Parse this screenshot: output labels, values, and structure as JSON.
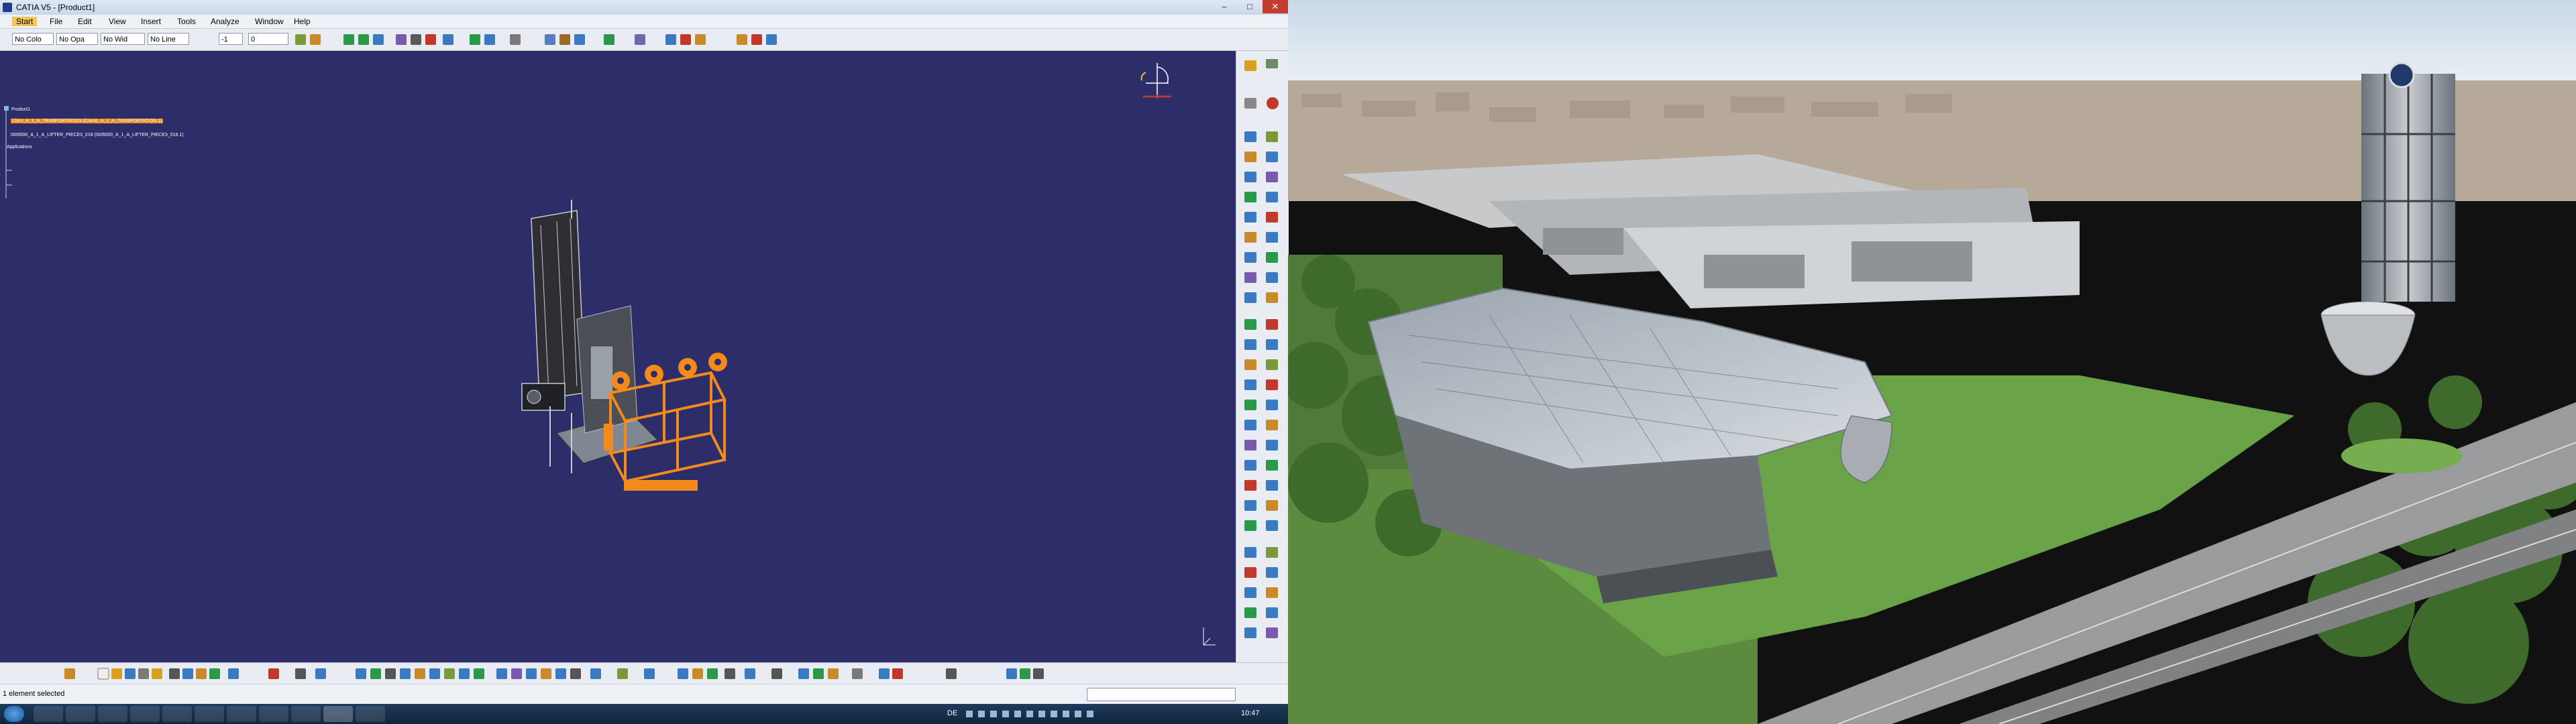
{
  "window": {
    "title": "CATIA V5 - [Product1]",
    "minimize": "–",
    "maximize": "□",
    "close": "✕"
  },
  "menu": {
    "items": [
      "Start",
      "File",
      "Edit",
      "View",
      "Insert",
      "Tools",
      "Analyze",
      "Window",
      "Help"
    ]
  },
  "toolbar": {
    "combos": [
      "No Colo",
      "No Opa",
      "No Wid",
      "No Line",
      "-1",
      "0"
    ]
  },
  "tree": {
    "root": "Product1",
    "selected_item": "Clam_A_1_A_TRASPORTATION (Clamp_A_1_A_TRASPORTATION.1)",
    "second_item": "00/6000_A_1_A_LIFTER_PIECE3_018 (00/6000_A_1_A_LIFTER_PIECE3_018.1)",
    "applications": "Applications"
  },
  "status": {
    "text": "1 element selected"
  },
  "taskbar": {
    "lang": "DE",
    "clock": "10:47"
  },
  "colors": {
    "viewport_bg": "#2d2d6a",
    "highlight_orange": "#f28a1c",
    "toolbar_bg": "#e9ecf2"
  },
  "icons": {
    "compass": "compass-icon",
    "catia_logo": "catia-logo-icon"
  }
}
